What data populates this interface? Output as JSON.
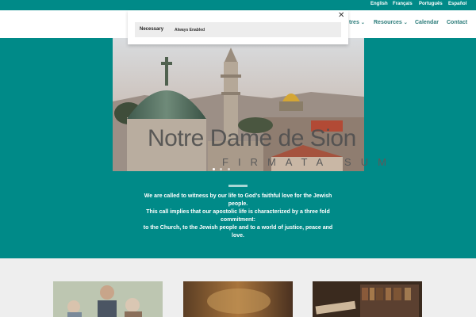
{
  "languages": [
    "English",
    "Français",
    "Português",
    "Español"
  ],
  "nav": {
    "items": [
      {
        "label": "tres",
        "has_dropdown": true
      },
      {
        "label": "Resources",
        "has_dropdown": true
      },
      {
        "label": "Calendar",
        "has_dropdown": false
      },
      {
        "label": "Contact",
        "has_dropdown": false
      }
    ]
  },
  "cookie": {
    "category": "Necessary",
    "status": "Always Enabled"
  },
  "hero": {
    "brand_text": "Notre Dame de Sion",
    "motto": "FIRMATA SUM",
    "slide_count": 3,
    "active_slide": 1
  },
  "mission": {
    "lines": [
      "We are called to witness by our life to God's faithful love for the Jewish people.",
      "This call implies that our apostolic life is characterized by a three fold commitment:",
      "to the Church, to the Jewish people and to a world of justice, peace and love."
    ]
  },
  "colors": {
    "brand_teal": "#008a88",
    "nav_text": "#2a7b79",
    "cookie_row_bg": "#ededed"
  }
}
